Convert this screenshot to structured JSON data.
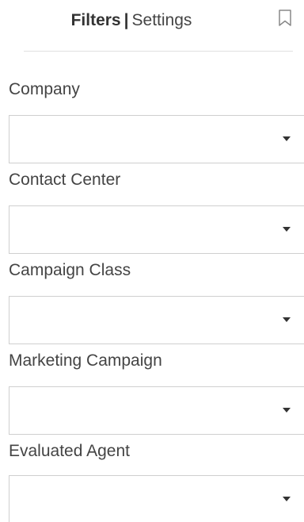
{
  "header": {
    "tab_filters": "Filters",
    "separator": "|",
    "tab_settings": "Settings",
    "bookmark_icon": "bookmark-outline-icon"
  },
  "filters": [
    {
      "label": "Company",
      "value": ""
    },
    {
      "label": "Contact Center",
      "value": ""
    },
    {
      "label": "Campaign Class",
      "value": ""
    },
    {
      "label": "Marketing Campaign",
      "value": ""
    },
    {
      "label": "Evaluated Agent",
      "value": ""
    }
  ],
  "colors": {
    "text": "#444444",
    "border": "#cfcfcf",
    "divider": "#e0e0e0"
  }
}
